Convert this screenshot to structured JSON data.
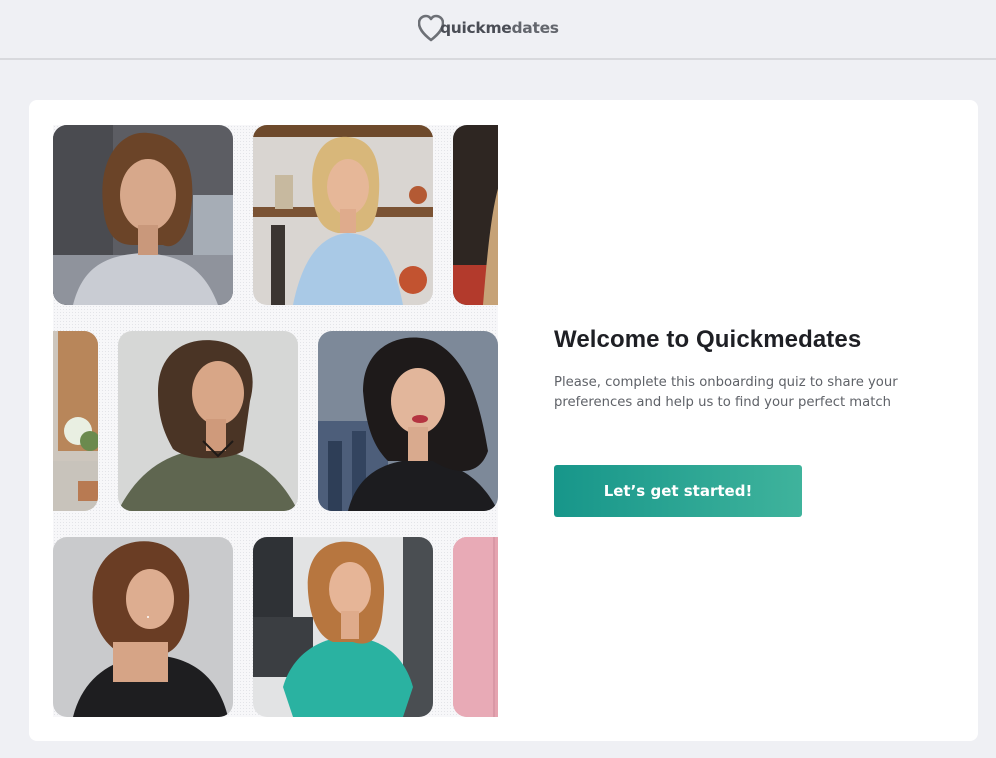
{
  "header": {
    "logo_part1": "quickme",
    "logo_part2": "dates",
    "logo_icon": "heart-icon",
    "brand_color": "#4a4d55"
  },
  "onboarding": {
    "title": "Welcome to Quickmedates",
    "description": "Please, complete this onboarding quiz to share your preferences and help us to find your perfect match",
    "cta_label": "Let’s get started!",
    "cta_gradient": [
      "#17968a",
      "#3fb39c"
    ]
  },
  "collage": {
    "photo_count": 9
  }
}
